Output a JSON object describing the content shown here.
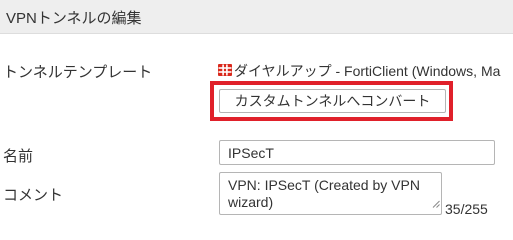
{
  "header": {
    "title": "VPNトンネルの編集"
  },
  "form": {
    "tunnel_template": {
      "label": "トンネルテンプレート",
      "icon": "forticlient-icon",
      "value": "ダイヤルアップ - FortiClient (Windows, Ma",
      "convert_button_label": "カスタムトンネルへコンバート",
      "highlight_color": "#e0202a"
    },
    "name": {
      "label": "名前",
      "value": "IPSecT"
    },
    "comment": {
      "label": "コメント",
      "value": "VPN: IPSecT (Created by VPN wizard)",
      "char_count": "35/255"
    }
  }
}
